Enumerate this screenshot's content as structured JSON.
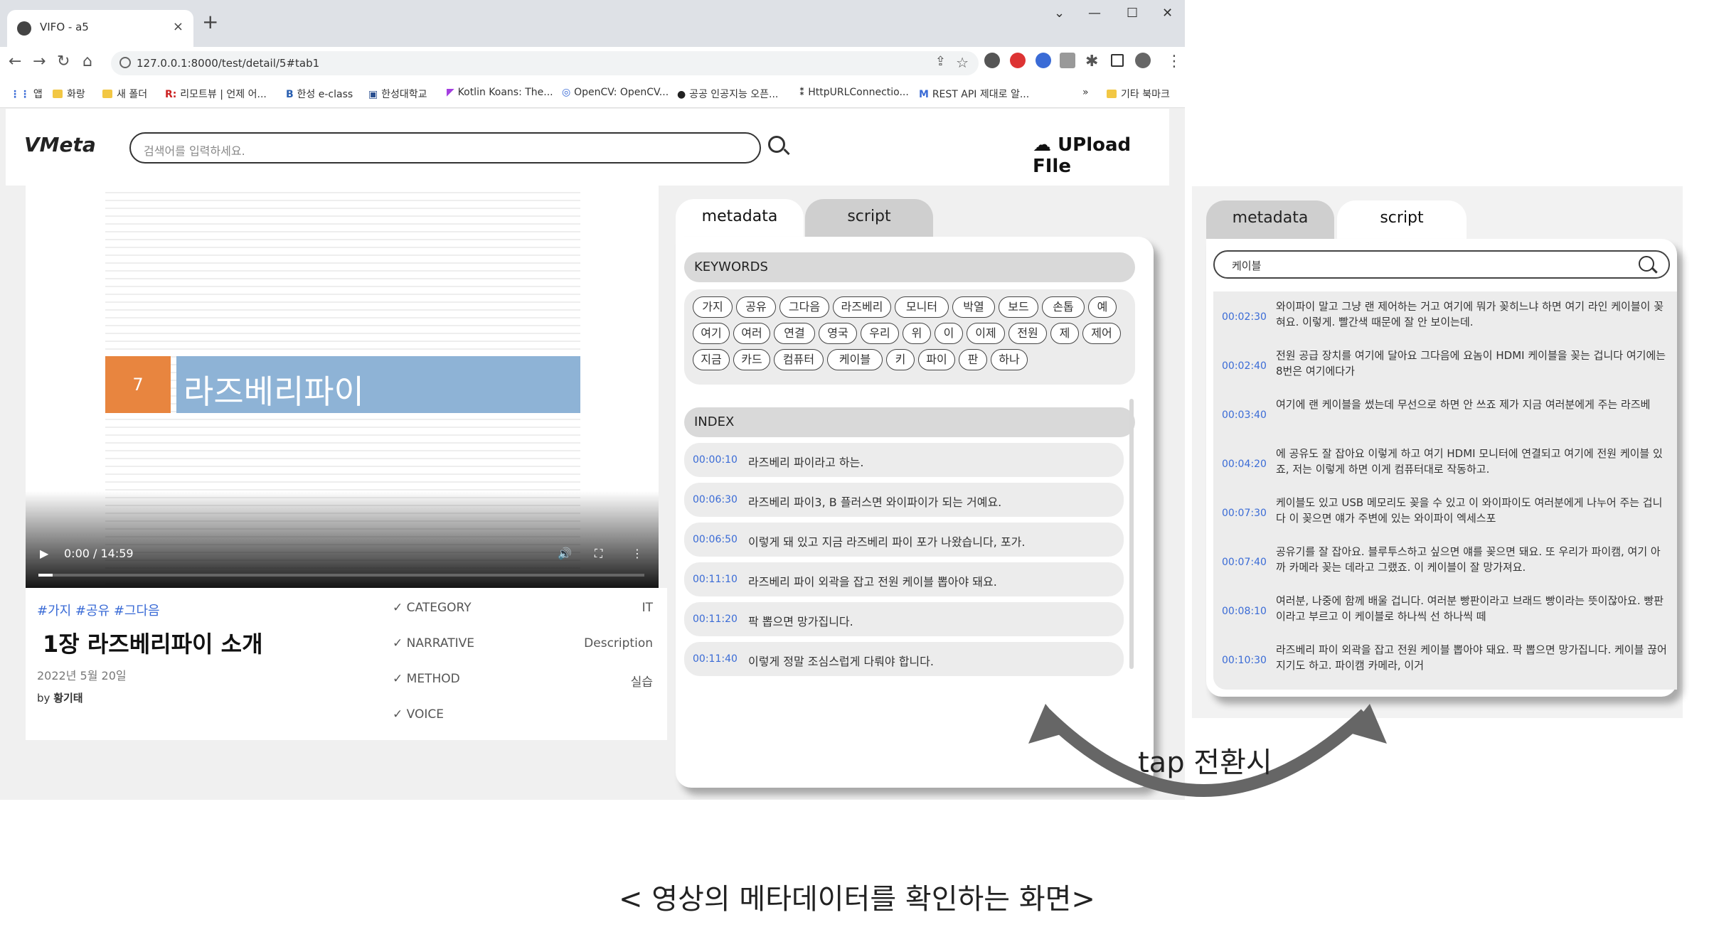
{
  "browser": {
    "tab_title": "VIFO - a5",
    "close": "×",
    "new_tab": "+",
    "url": "127.0.0.1:8000/test/detail/5#tab1",
    "bookmarks": [
      "앱",
      "화랑",
      "새 폴더",
      "리모트뷰 | 언제 어...",
      "한성 e-class",
      "한성대학교",
      "Kotlin Koans: The...",
      "OpenCV: OpenCV...",
      "공공 인공지능 오픈...",
      "HttpURLConnectio...",
      "REST API 제대로 알..."
    ],
    "bookmarks_more": "»",
    "other_bookmarks": "기타 북마크"
  },
  "header": {
    "logo": "VMeta",
    "search_placeholder": "검색어를 입력하세요.",
    "upload": "UPload FIle"
  },
  "video": {
    "slide_number": "7",
    "slide_title": "라즈베리파이",
    "time": "0:00 / 14:59"
  },
  "info": {
    "tags": "#가지 #공유 #그다음",
    "title": "1장 라즈베리파이 소개",
    "date": "2022년 5월 20일",
    "by_label": "by",
    "author": "황기태",
    "meta": [
      {
        "label": "✓ CATEGORY",
        "value": "IT"
      },
      {
        "label": "✓ NARRATIVE",
        "value": "Description"
      },
      {
        "label": "✓ METHOD",
        "value": "실습"
      },
      {
        "label": "✓ VOICE",
        "value": ""
      }
    ]
  },
  "tabs": {
    "metadata": "metadata",
    "script": "script"
  },
  "keywords": {
    "heading": "KEYWORDS",
    "rows": [
      [
        "가지",
        "공유",
        "그다음",
        "라즈베리",
        "모니터",
        "박열",
        "보드",
        "손톱",
        "예"
      ],
      [
        "여기",
        "여러",
        "연결",
        "영국",
        "우리",
        "위",
        "이",
        "이제",
        "전원",
        "제",
        "제어"
      ],
      [
        "지금",
        "카드",
        "컴퓨터",
        "케이블",
        "키",
        "파이",
        "판",
        "하나"
      ]
    ]
  },
  "index": {
    "heading": "INDEX",
    "items": [
      {
        "time": "00:00:10",
        "text": "라즈베리 파이라고 하는."
      },
      {
        "time": "00:06:30",
        "text": "라즈베리 파이3, B 플러스면 와이파이가 되는 거예요."
      },
      {
        "time": "00:06:50",
        "text": "이렇게 돼 있고 지금 라즈베리 파이 포가 나왔습니다, 포가."
      },
      {
        "time": "00:11:10",
        "text": "라즈베리 파이 외곽을 잡고 전원 케이블 뽑아야 돼요."
      },
      {
        "time": "00:11:20",
        "text": "팍 뽑으면 망가집니다."
      },
      {
        "time": "00:11:40",
        "text": "이렇게 정말 조심스럽게 다뤄야 합니다."
      }
    ]
  },
  "script": {
    "search_value": "케이블",
    "items": [
      {
        "time": "00:02:30",
        "text": "와이파이 말고 그냥 랜 제어하는 거고 여기에 뭐가 꽂히느냐 하면 여기 라인 케이블이 꽂혀요. 이렇게. 빨간색 때문에 잘 안 보이는데."
      },
      {
        "time": "00:02:40",
        "text": "전원 공급 장치를 여기에 달아요 그다음에 요놈이 HDMI 케이블을 꽂는 겁니다 여기에는 8번은 여기에다가"
      },
      {
        "time": "00:03:40",
        "text": "여기에 랜 케이블을 썼는데 무선으로 하면 안 쓰죠 제가 지금 여러분에게 주는 라즈베"
      },
      {
        "time": "00:04:20",
        "text": "에 공유도 잘 잡아요 이렇게 하고 여기 HDMI 모니터에 연결되고 여기에 전원 케이블 있죠, 저는 이렇게 하면 이게 컴퓨터대로 작동하고."
      },
      {
        "time": "00:07:30",
        "text": "케이블도 있고 USB 메모리도 꽂을 수 있고 이 와이파이도 여러분에게 나누어 주는 겁니다 이 꽂으면 얘가 주변에 있는 와이파이 엑세스포"
      },
      {
        "time": "00:07:40",
        "text": "공유기를 잘 잡아요. 블루투스하고 싶으면 얘를 꽂으면 돼요. 또 우리가 파이캠, 여기 아까 카메라 꽂는 데라고 그랬죠. 이 케이블이 잘 망가져요."
      },
      {
        "time": "00:08:10",
        "text": "여러분, 나중에 함께 배울 겁니다. 여러분 빵판이라고 브래드 빵이라는 뜻이잖아요. 빵판이라고 부르고 이 케이블로 하나씩 선 하나씩 떼"
      },
      {
        "time": "00:10:30",
        "text": "라즈베리 파이 외곽을 잡고 전원 케이블 뽑아야 돼요. 팍 뽑으면 망가집니다. 케이블 끊어지기도 하고. 파이캠 카메라, 이거"
      }
    ]
  },
  "annotation": {
    "tap_text": "tap 전환시"
  },
  "caption": "< 영상의 메타데이터를 확인하는 화면>"
}
